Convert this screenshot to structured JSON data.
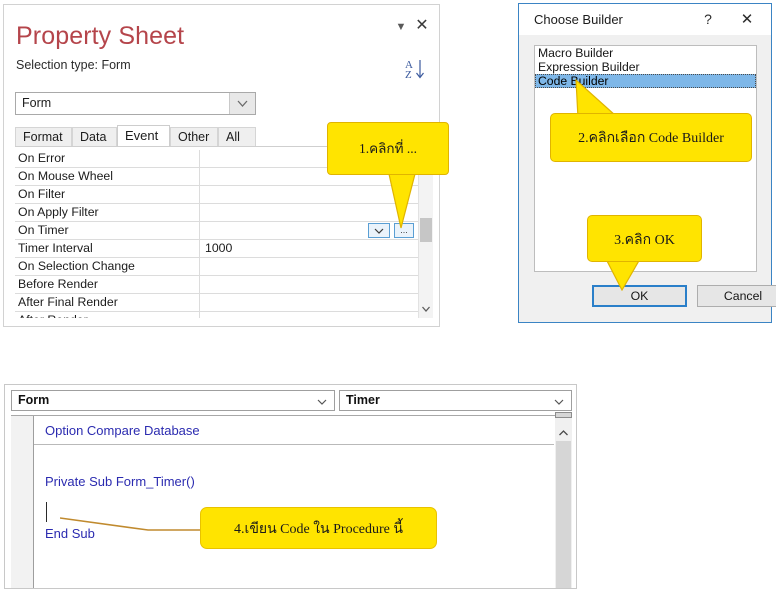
{
  "property_sheet": {
    "title": "Property Sheet",
    "selection_type_label": "Selection type:  Form",
    "collapse_icon": "caret-down-icon",
    "close_icon": "close-icon",
    "sort_icon": "sort-az-icon",
    "object_selector": {
      "value": "Form",
      "dropdown_icon": "chevron-down-icon"
    },
    "tabs": [
      {
        "label": "Format",
        "active": false
      },
      {
        "label": "Data",
        "active": false
      },
      {
        "label": "Event",
        "active": true
      },
      {
        "label": "Other",
        "active": false
      },
      {
        "label": "All",
        "active": false
      }
    ],
    "rows": [
      {
        "name": "On Error",
        "value": ""
      },
      {
        "name": "On Mouse Wheel",
        "value": ""
      },
      {
        "name": "On Filter",
        "value": ""
      },
      {
        "name": "On Apply Filter",
        "value": ""
      },
      {
        "name": "On Timer",
        "value": "",
        "active": true
      },
      {
        "name": "Timer Interval",
        "value": "1000"
      },
      {
        "name": "On Selection Change",
        "value": ""
      },
      {
        "name": "Before Render",
        "value": ""
      },
      {
        "name": "After Final Render",
        "value": ""
      },
      {
        "name": "After Render",
        "value": ""
      }
    ],
    "dropdown_button_glyph": "chevron-down-icon",
    "build_button_label": "...",
    "scroll_down_icon": "chevron-down-icon"
  },
  "choose_builder": {
    "title": "Choose Builder",
    "help_label": "?",
    "help_icon": "question-mark-icon",
    "close_icon": "close-icon",
    "items": [
      {
        "label": "Macro Builder",
        "selected": false
      },
      {
        "label": "Expression Builder",
        "selected": false
      },
      {
        "label": "Code Builder",
        "selected": true
      }
    ],
    "ok_label": "OK",
    "cancel_label": "Cancel"
  },
  "vba_editor": {
    "object_combo": {
      "value": "Form",
      "dropdown_icon": "chevron-down-icon"
    },
    "procedure_combo": {
      "value": "Timer",
      "dropdown_icon": "chevron-down-icon"
    },
    "code_lines": [
      "Option Compare Database",
      "Private Sub Form_Timer()",
      "End Sub"
    ],
    "scroll_up_icon": "chevron-up-icon"
  },
  "callouts": {
    "step1": "1.คลิกที่ ...",
    "step2": "2.คลิกเลือก Code Builder",
    "step3": "3.คลิก OK",
    "step4": "4.เขียน Code ใน Procedure นี้"
  },
  "colors": {
    "callout_fill": "#ffe400",
    "callout_border": "#e0b400",
    "title_text": "#b5454b",
    "code_text": "#2b2bb0",
    "selection_blue": "#7eb7e8",
    "dialog_border": "#3b84c4",
    "leader_line": "#c08a2e"
  }
}
